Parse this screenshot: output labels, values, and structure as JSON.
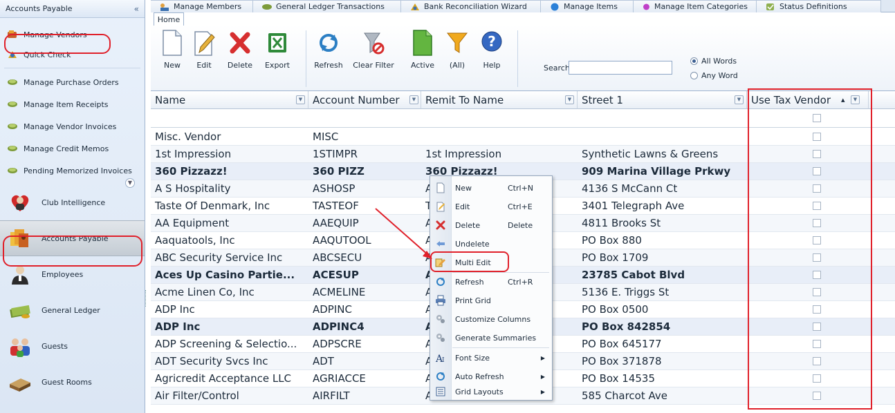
{
  "sidebar": {
    "title": "Accounts Payable",
    "collapse_glyph": "«",
    "links": [
      {
        "label": "Manage Vendors",
        "icon": "vendors-icon"
      },
      {
        "label": "Quick Check",
        "icon": "quick-check-icon"
      },
      {
        "label": "Manage Purchase Orders",
        "icon": "money-icon"
      },
      {
        "label": "Manage Item Receipts",
        "icon": "money-icon"
      },
      {
        "label": "Manage Vendor Invoices",
        "icon": "money-icon"
      },
      {
        "label": "Manage Credit Memos",
        "icon": "money-icon"
      },
      {
        "label": "Pending Memorized Invoices",
        "icon": "money-icon"
      }
    ],
    "modules": [
      {
        "label": "Club Intelligence",
        "icon": "heart-person-icon"
      },
      {
        "label": "Accounts Payable",
        "icon": "accounts-payable-icon"
      },
      {
        "label": "Employees",
        "icon": "employee-icon"
      },
      {
        "label": "General Ledger",
        "icon": "money-stack-icon"
      },
      {
        "label": "Guests",
        "icon": "guests-icon"
      },
      {
        "label": "Guest Rooms",
        "icon": "bed-icon"
      }
    ]
  },
  "tabs": [
    {
      "label": "Manage Members",
      "icon": "members-icon"
    },
    {
      "label": "General Ledger Transactions",
      "icon": "money-icon"
    },
    {
      "label": "Bank Reconciliation Wizard",
      "icon": "wizard-icon"
    },
    {
      "label": "Manage Items",
      "icon": "globe-icon"
    },
    {
      "label": "Manage Item Categories",
      "icon": "purple-globe-icon"
    },
    {
      "label": "Status Definitions",
      "icon": "status-icon"
    }
  ],
  "ribbon": {
    "tab": "Home",
    "buttons": [
      {
        "label": "New",
        "icon": "new-doc-icon"
      },
      {
        "label": "Edit",
        "icon": "edit-pencil-icon"
      },
      {
        "label": "Delete",
        "icon": "delete-x-icon"
      },
      {
        "label": "Export",
        "icon": "excel-icon"
      },
      {
        "label": "Refresh",
        "icon": "refresh-icon"
      },
      {
        "label": "Clear Filter",
        "icon": "clear-filter-icon"
      },
      {
        "label": "Active",
        "icon": "green-doc-icon"
      },
      {
        "label": "(All)",
        "icon": "funnel-icon"
      },
      {
        "label": "Help",
        "icon": "help-icon"
      }
    ],
    "search_label": "Search:",
    "search_value": "",
    "match_options": [
      {
        "label": "All Words",
        "selected": true
      },
      {
        "label": "Any Word",
        "selected": false
      }
    ]
  },
  "grid": {
    "columns": [
      "Name",
      "Account Number",
      "Remit To Name",
      "Street 1",
      "Use Tax Vendor"
    ],
    "sort_glyph": "▴",
    "rows": [
      {
        "name": "Misc. Vendor",
        "account": "MISC",
        "remit": "",
        "street": "",
        "bold": false
      },
      {
        "name": "1st Impression",
        "account": "1STIMPR",
        "remit": "1st Impression",
        "street": "Synthetic Lawns & Greens",
        "bold": false
      },
      {
        "name": "360 Pizzazz!",
        "account": "360 PIZZ",
        "remit": "360 Pizzazz!",
        "street": "909 Marina Village Prkwy",
        "bold": true
      },
      {
        "name": "A S Hospitality",
        "account": "ASHOSP",
        "remit": "A",
        "street": "4136 S McCann Ct",
        "bold": false
      },
      {
        "name": "Taste Of Denmark, Inc",
        "account": "TASTEOF",
        "remit": "T",
        "street": "3401 Telegraph Ave",
        "bold": false
      },
      {
        "name": "AA Equipment",
        "account": "AAEQUIP",
        "remit": "A",
        "street": "4811 Brooks St",
        "bold": false
      },
      {
        "name": "Aaquatools, Inc",
        "account": "AAQUTOOL",
        "remit": "A",
        "street": "PO Box 880",
        "bold": false
      },
      {
        "name": "ABC Security Service Inc",
        "account": "ABCSECU",
        "remit": "A                      c",
        "street": "PO Box 1709",
        "bold": false
      },
      {
        "name": "Aces Up Casino Partie...",
        "account": "ACESUP",
        "remit": "A                      ie...",
        "street": "23785 Cabot Blvd",
        "bold": true
      },
      {
        "name": "Acme Linen Co, Inc",
        "account": "ACMELINE",
        "remit": "A",
        "street": "5136 E. Triggs St",
        "bold": false
      },
      {
        "name": "ADP Inc",
        "account": "ADPINC",
        "remit": "A",
        "street": "PO Box 0500",
        "bold": false
      },
      {
        "name": "ADP Inc",
        "account": "ADPINC4",
        "remit": "A",
        "street": "PO Box 842854",
        "bold": true
      },
      {
        "name": "ADP Screening & Selectio...",
        "account": "ADPSCRE",
        "remit": "A                      io...",
        "street": "PO Box 645177",
        "bold": false
      },
      {
        "name": "ADT Security Svcs Inc",
        "account": "ADT",
        "remit": "A",
        "street": "PO Box 371878",
        "bold": false
      },
      {
        "name": "Agricredit Acceptance LLC",
        "account": "AGRIACCE",
        "remit": "A                     LC",
        "street": "PO Box 14535",
        "bold": false
      },
      {
        "name": "Air Filter/Control",
        "account": "AIRFILT",
        "remit": "Air Filter/Control",
        "street": "585 Charcot Ave",
        "bold": false
      }
    ]
  },
  "context_menu": [
    {
      "label": "New",
      "shortcut": "Ctrl+N",
      "icon": "new-doc-icon",
      "submenu": false
    },
    {
      "label": "Edit",
      "shortcut": "Ctrl+E",
      "icon": "edit-pencil-icon",
      "submenu": false
    },
    {
      "label": "Delete",
      "shortcut": "Delete",
      "icon": "delete-x-icon",
      "submenu": false
    },
    {
      "label": "Undelete",
      "shortcut": "",
      "icon": "undelete-icon",
      "submenu": false
    },
    {
      "label": "Multi Edit",
      "shortcut": "",
      "icon": "multi-edit-icon",
      "submenu": false
    },
    {
      "label": "Refresh",
      "shortcut": "Ctrl+R",
      "icon": "refresh-icon",
      "submenu": false
    },
    {
      "label": "Print Grid",
      "shortcut": "",
      "icon": "printer-icon",
      "submenu": false
    },
    {
      "label": "Customize Columns",
      "shortcut": "",
      "icon": "gears-icon",
      "submenu": false
    },
    {
      "label": "Generate Summaries",
      "shortcut": "",
      "icon": "gears-icon",
      "submenu": false
    },
    {
      "label": "Font Size",
      "shortcut": "",
      "icon": "font-size-icon",
      "submenu": true
    },
    {
      "label": "Auto Refresh",
      "shortcut": "",
      "icon": "refresh-icon",
      "submenu": true
    },
    {
      "label": "Grid Layouts",
      "shortcut": "",
      "icon": "grid-layout-icon",
      "submenu": true
    }
  ],
  "colors": {
    "highlight_red": "#e0202a",
    "sidebar_bg": "#dbe6f4",
    "grid_border": "#c8d3e0"
  }
}
